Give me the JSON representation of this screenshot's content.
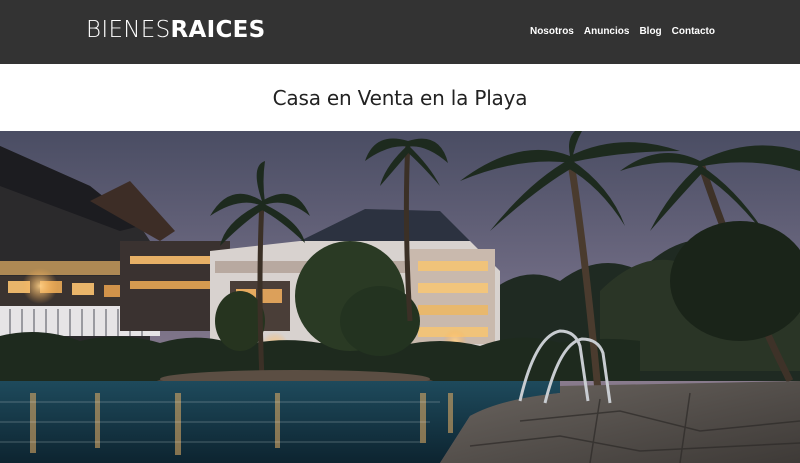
{
  "header": {
    "logo_light": "BIENES",
    "logo_bold": "RAICES",
    "nav": [
      {
        "label": "Nosotros"
      },
      {
        "label": "Anuncios"
      },
      {
        "label": "Blog"
      },
      {
        "label": "Contacto"
      }
    ]
  },
  "page": {
    "title": "Casa en Venta en la Playa"
  },
  "hero": {
    "image_icon": "resort-pool-at-dusk-photo"
  },
  "colors": {
    "header_bg": "#333333",
    "text_light": "#ffffff",
    "title_text": "#222222"
  }
}
